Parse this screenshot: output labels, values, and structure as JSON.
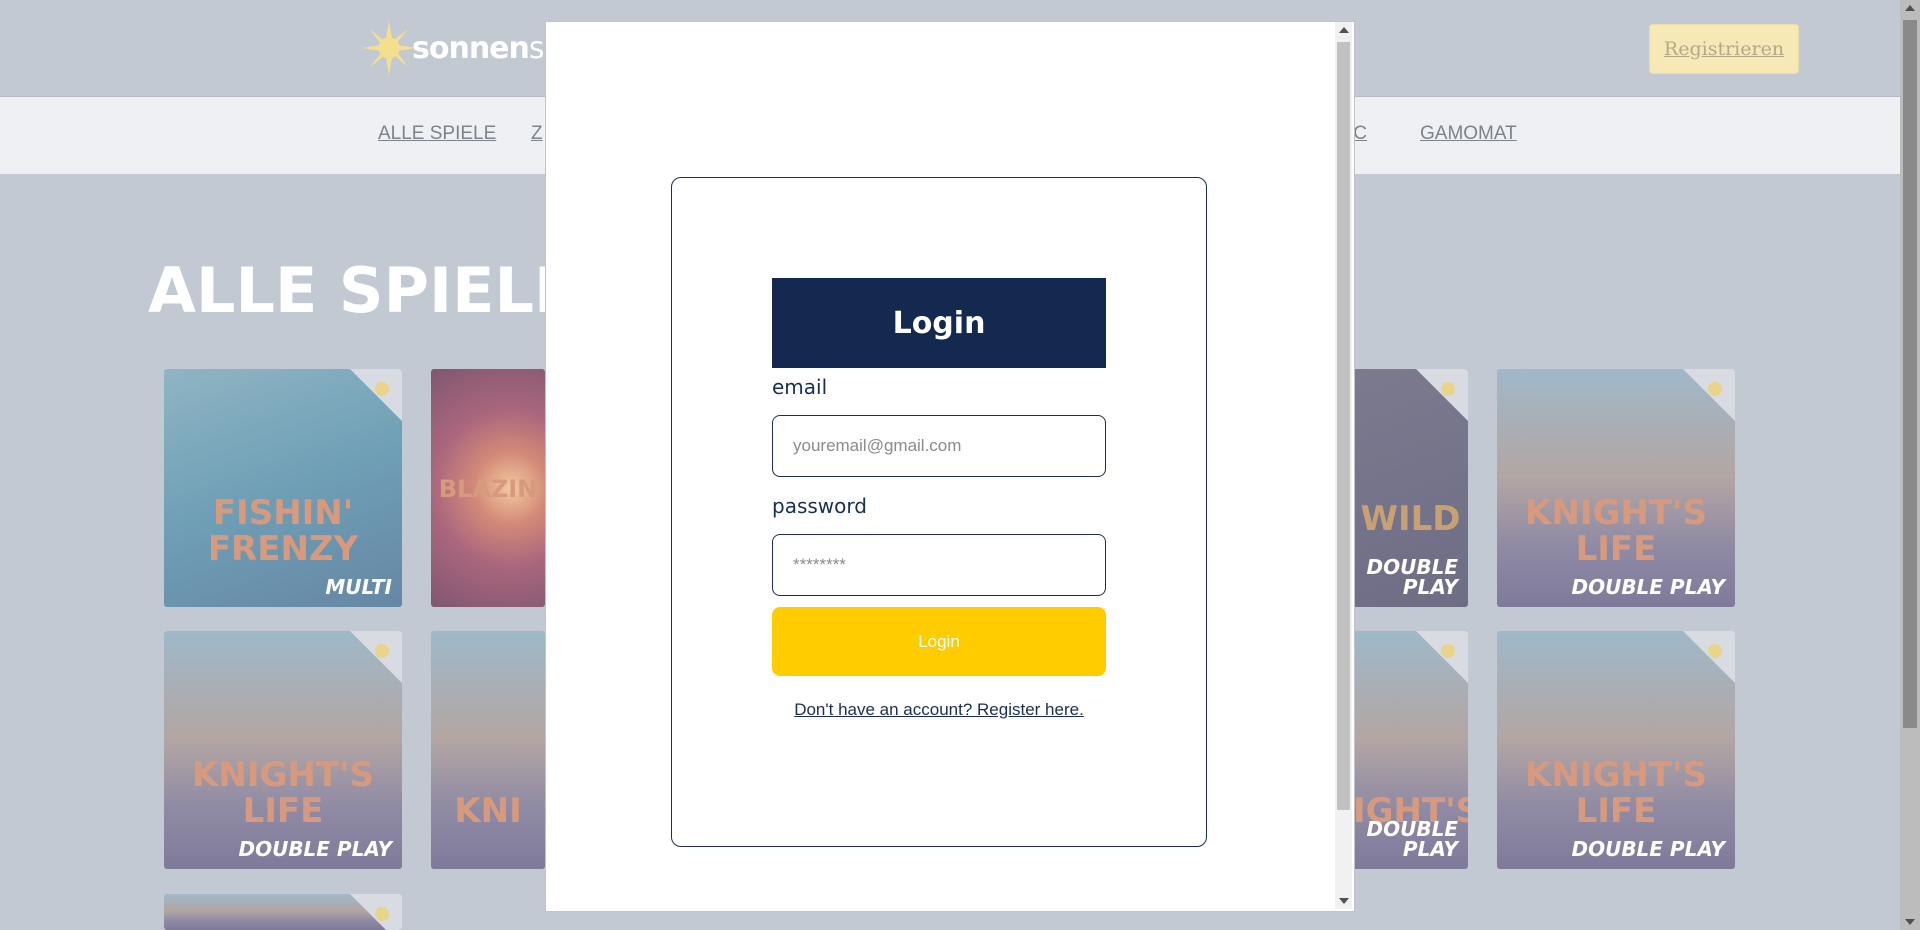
{
  "header": {
    "logo_bold": "sonnen",
    "logo_light": "spie",
    "register_label": "Registrieren"
  },
  "nav": {
    "items": [
      "ALLE SPIELE",
      "Z",
      "IC",
      "GAMOMAT"
    ]
  },
  "section": {
    "title": "ALLE SPIELE"
  },
  "tiles": [
    {
      "name": "FISHIN' FRENZY",
      "sub": "MULTI"
    },
    {
      "name": "BLAZIN",
      "sub": ""
    },
    {
      "name": "WILD",
      "sub": "DOUBLE PLAY"
    },
    {
      "name": "KNIGHT'S LIFE",
      "sub": "DOUBLE PLAY"
    },
    {
      "name": "KNIGHT'S LIFE",
      "sub": "DOUBLE PLAY"
    },
    {
      "name": "KNI",
      "sub": ""
    },
    {
      "name": "IGHT'S",
      "sub": "DOUBLE PLAY"
    },
    {
      "name": "KNIGHT'S LIFE",
      "sub": "DOUBLE PLAY"
    }
  ],
  "modal": {
    "title": "Login",
    "email_label": "email",
    "email_placeholder": "youremail@gmail.com",
    "password_label": "password",
    "password_placeholder": "********",
    "submit_label": "Login",
    "register_link": "Don't have an account? Register here."
  },
  "colors": {
    "primary": "#13294f",
    "accent": "#ffcc00",
    "overlay": "#c3c9d3"
  }
}
